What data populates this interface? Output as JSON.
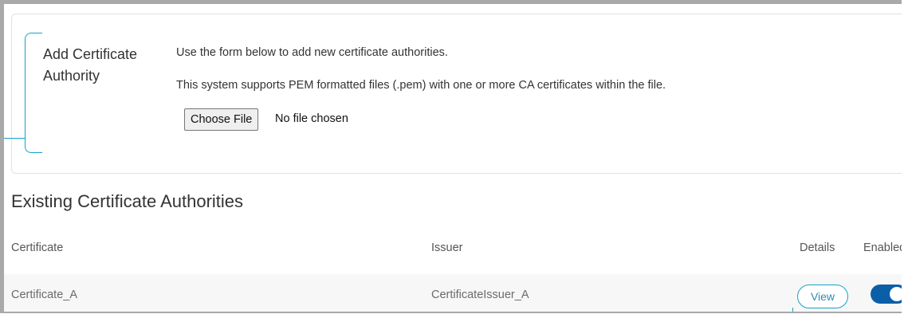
{
  "add_panel": {
    "title": "Add Certificate Authority",
    "description_line1": "Use the form below to add new certificate authorities.",
    "description_line2": "This system supports PEM formatted files (.pem) with one or more CA certificates within the file.",
    "choose_file_label": "Choose File",
    "file_status": "No file chosen"
  },
  "existing": {
    "section_title": "Existing Certificate Authorities",
    "columns": {
      "certificate": "Certificate",
      "issuer": "Issuer",
      "details": "Details",
      "enabled": "Enabled"
    },
    "rows": [
      {
        "certificate": "Certificate_A",
        "issuer": "CertificateIssuer_A",
        "details_label": "View",
        "enabled": true
      }
    ]
  },
  "colors": {
    "accent": "#14a3c7",
    "toggle_on": "#0b5ea8",
    "frame_border": "#a9a9a9",
    "row_background": "#f7f7f7"
  }
}
